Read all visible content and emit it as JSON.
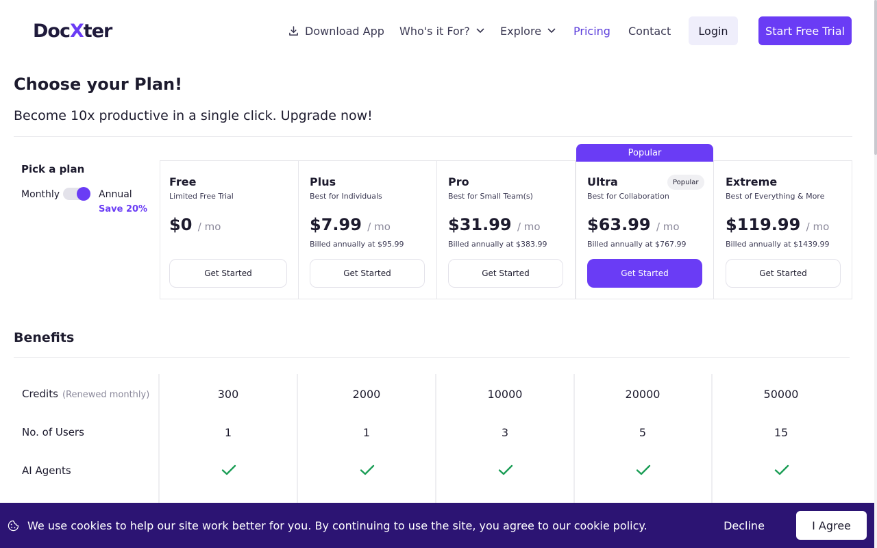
{
  "brand": {
    "logo_doc": "Doc",
    "logo_x": "X",
    "logo_ter": "ter"
  },
  "nav": {
    "download": "Download App",
    "whos_for": "Who's it For?",
    "explore": "Explore",
    "pricing": "Pricing",
    "contact": "Contact",
    "login": "Login",
    "start_trial": "Start Free Trial"
  },
  "heading": {
    "title": "Choose your Plan!",
    "subtitle": "Become 10x productive in a single click. Upgrade now!"
  },
  "picker": {
    "title": "Pick a plan",
    "monthly": "Monthly",
    "annual": "Annual",
    "save": "Save 20%",
    "annual_selected": true
  },
  "popular_tab": "Popular",
  "plans": [
    {
      "name": "Free",
      "tagline": "Limited Free Trial",
      "price": "$0",
      "per": "/ mo",
      "billed": "",
      "cta": "Get Started"
    },
    {
      "name": "Plus",
      "tagline": "Best for Individuals",
      "price": "$7.99",
      "per": "/ mo",
      "billed": "Billed annually at $95.99",
      "cta": "Get Started"
    },
    {
      "name": "Pro",
      "tagline": "Best for Small Team(s)",
      "price": "$31.99",
      "per": "/ mo",
      "billed": "Billed annually at $383.99",
      "cta": "Get Started"
    },
    {
      "name": "Ultra",
      "tagline": "Best for Collaboration",
      "price": "$63.99",
      "per": "/ mo",
      "billed": "Billed annually at $767.99",
      "cta": "Get Started",
      "badge": "Popular"
    },
    {
      "name": "Extreme",
      "tagline": "Best of Everything & More",
      "price": "$119.99",
      "per": "/ mo",
      "billed": "Billed annually at $1439.99",
      "cta": "Get Started"
    }
  ],
  "benefits": {
    "title": "Benefits",
    "rows": [
      {
        "label": "Credits",
        "note": "(Renewed monthly)",
        "values": [
          "300",
          "2000",
          "10000",
          "20000",
          "50000"
        ]
      },
      {
        "label": "No. of Users",
        "values": [
          "1",
          "1",
          "3",
          "5",
          "15"
        ]
      },
      {
        "label": "AI Agents",
        "values": [
          true,
          true,
          true,
          true,
          true
        ]
      }
    ]
  },
  "cookie": {
    "text": "We use cookies to help our site work better for you. By continuing to use the site, you agree to our cookie policy.",
    "decline": "Decline",
    "agree": "I Agree"
  },
  "colors": {
    "accent": "#6a3cf5",
    "banner": "#2c1473",
    "check": "#1a9d55"
  },
  "icons": [
    "download-icon",
    "chevron-down-icon",
    "cookie-icon",
    "check-icon"
  ]
}
